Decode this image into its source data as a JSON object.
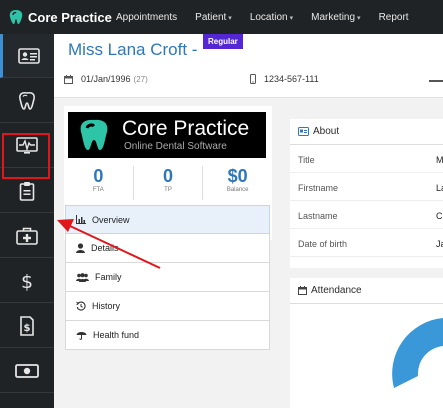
{
  "app": {
    "brand": "Core Practice"
  },
  "topnav": {
    "items": [
      {
        "label": "Appointments",
        "caret": ""
      },
      {
        "label": "Patient",
        "caret": "▾"
      },
      {
        "label": "Location",
        "caret": "▾"
      },
      {
        "label": "Marketing",
        "caret": "▾"
      },
      {
        "label": "Report",
        "caret": ""
      }
    ]
  },
  "sidebar": {
    "items": [
      {
        "icon": "id-card-icon",
        "active": true
      },
      {
        "icon": "tooth-icon",
        "active": false
      },
      {
        "icon": "pulse-monitor-icon",
        "active": false
      },
      {
        "icon": "clipboard-icon",
        "active": false,
        "highlighted": true
      },
      {
        "icon": "medical-kit-icon",
        "active": false
      },
      {
        "icon": "dollar-icon",
        "active": false
      },
      {
        "icon": "invoice-icon",
        "active": false
      },
      {
        "icon": "cash-icon",
        "active": false
      }
    ]
  },
  "patient": {
    "name": "Miss Lana Croft -",
    "badge": "Regular",
    "dob": "01/Jan/1996",
    "age": "(27)",
    "phone": "1234-567-111"
  },
  "profile": {
    "logo_title": "Core Practice",
    "logo_subtitle": "Online Dental Software",
    "stats": [
      {
        "value": "0",
        "label": "FTA"
      },
      {
        "value": "0",
        "label": "TP"
      },
      {
        "value": "$0",
        "label": "Balance"
      }
    ]
  },
  "tabs": [
    {
      "label": "Overview",
      "icon": "bar-chart-icon",
      "active": true
    },
    {
      "label": "Details",
      "icon": "user-icon",
      "active": false
    },
    {
      "label": "Family",
      "icon": "users-icon",
      "active": false
    },
    {
      "label": "History",
      "icon": "history-icon",
      "active": false
    },
    {
      "label": "Health fund",
      "icon": "umbrella-icon",
      "active": false
    }
  ],
  "about": {
    "title": "About",
    "rows": [
      {
        "key": "Title",
        "value": "M"
      },
      {
        "key": "Firstname",
        "value": "La"
      },
      {
        "key": "Lastname",
        "value": "C"
      },
      {
        "key": "Date of birth",
        "value": "Ja"
      }
    ]
  },
  "attendance": {
    "title": "Attendance"
  },
  "colors": {
    "nav_bg": "#1f2326",
    "accent_blue": "#2e77b8",
    "badge_purple": "#5526d4",
    "highlight_red": "#e0161b",
    "donut_blue": "#3a97d8"
  }
}
